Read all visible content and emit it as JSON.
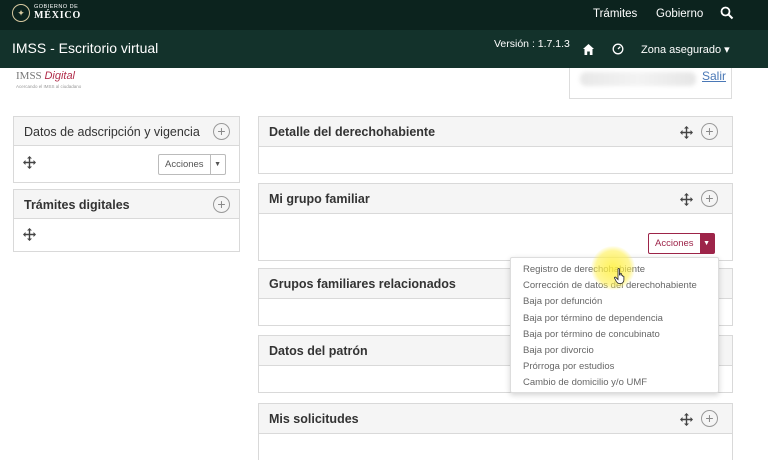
{
  "gov_bar": {
    "logo_small": "GOBIERNO DE",
    "logo_big": "MÉXICO",
    "links": [
      "Trámites",
      "Gobierno"
    ],
    "search_icon": "search-icon"
  },
  "app_bar": {
    "title": "IMSS - Escritorio virtual",
    "version": "Versión : 1.7.1.3",
    "zona": "Zona asegurado ▾"
  },
  "imss_logo": {
    "imss": "IMSS",
    "digital": "Digital",
    "tagline": "Acercando el IMSS al ciudadano"
  },
  "user": {
    "salir": "Salir"
  },
  "panels": {
    "adscripcion": {
      "title": "Datos de adscripción y vigencia",
      "acciones": "Acciones"
    },
    "tramites": {
      "title": "Trámites digitales"
    },
    "detalle": {
      "title": "Detalle del derechohabiente"
    },
    "grupo": {
      "title": "Mi grupo familiar",
      "acciones": "Acciones"
    },
    "relacionados": {
      "title": "Grupos familiares relacionados"
    },
    "patron": {
      "title": "Datos del patrón"
    },
    "solicitudes": {
      "title": "Mis solicitudes"
    }
  },
  "dropdown": {
    "items": [
      "Registro de derechohabiente",
      "Corrección de datos del derechohabiente",
      "Baja por defunción",
      "Baja por término de dependencia",
      "Baja por término de concubinato",
      "Baja por divorcio",
      "Prórroga por estudios",
      "Cambio de domicilio y/o UMF"
    ]
  },
  "colors": {
    "gov_bar": "#0c231e",
    "app_bar": "#13322b",
    "accent": "#9d2449"
  }
}
